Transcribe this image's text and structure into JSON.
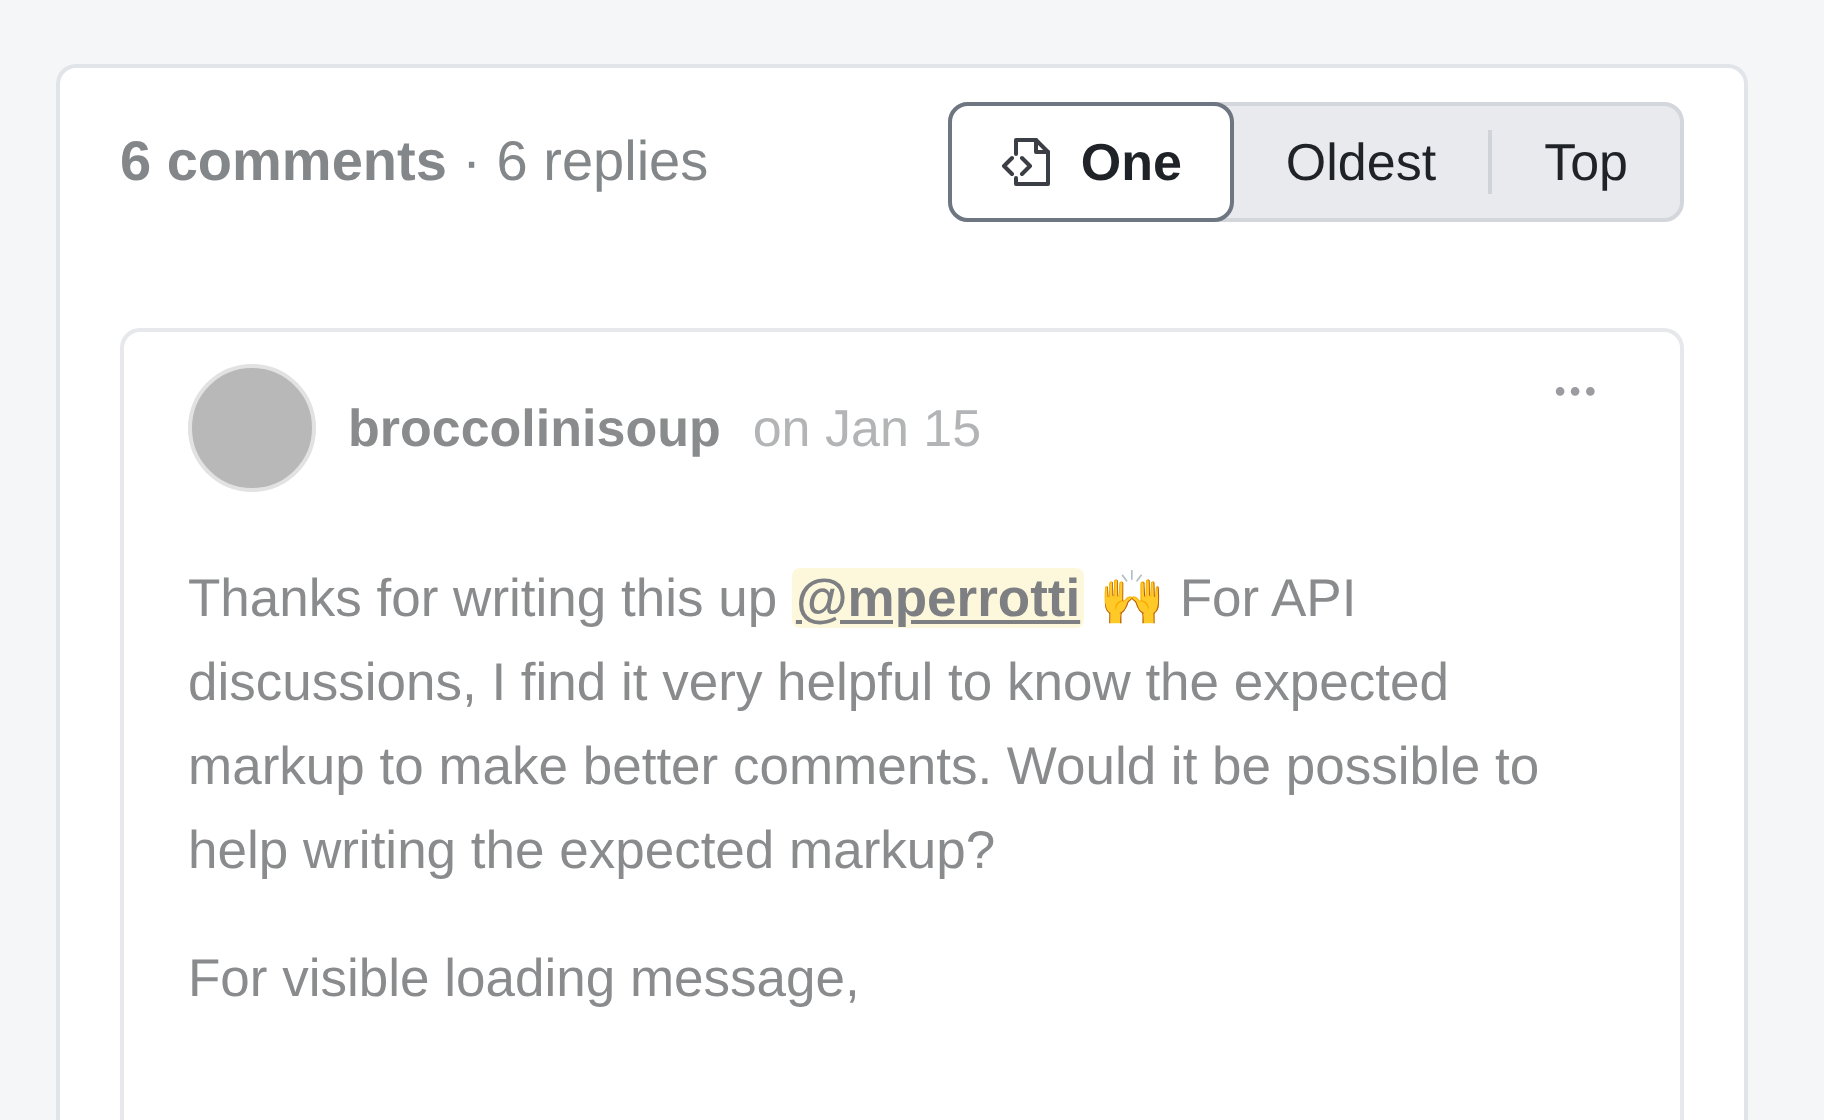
{
  "header": {
    "comments": "6 comments",
    "separator": "·",
    "replies": "6 replies"
  },
  "sort_tabs": [
    {
      "label": "One",
      "kind": "with-icon",
      "selected": true
    },
    {
      "label": "Oldest",
      "kind": "plain",
      "selected": false
    },
    {
      "label": "Top",
      "kind": "plain",
      "selected": false
    }
  ],
  "comment": {
    "author": "broccolinisoup",
    "date": "on Jan 15",
    "menu": "•••",
    "paragraphs": [
      [
        {
          "kind": "text",
          "text": "Thanks for writing this up "
        },
        {
          "kind": "mention",
          "text": "@mperrotti"
        },
        {
          "kind": "text",
          "text": " 🙌 For API discussions, I find it very helpful to know the expected markup to make better comments. Would it be possible to help writing the expected markup?"
        }
      ],
      [
        {
          "kind": "text",
          "text": "For visible loading message,"
        }
      ]
    ]
  }
}
